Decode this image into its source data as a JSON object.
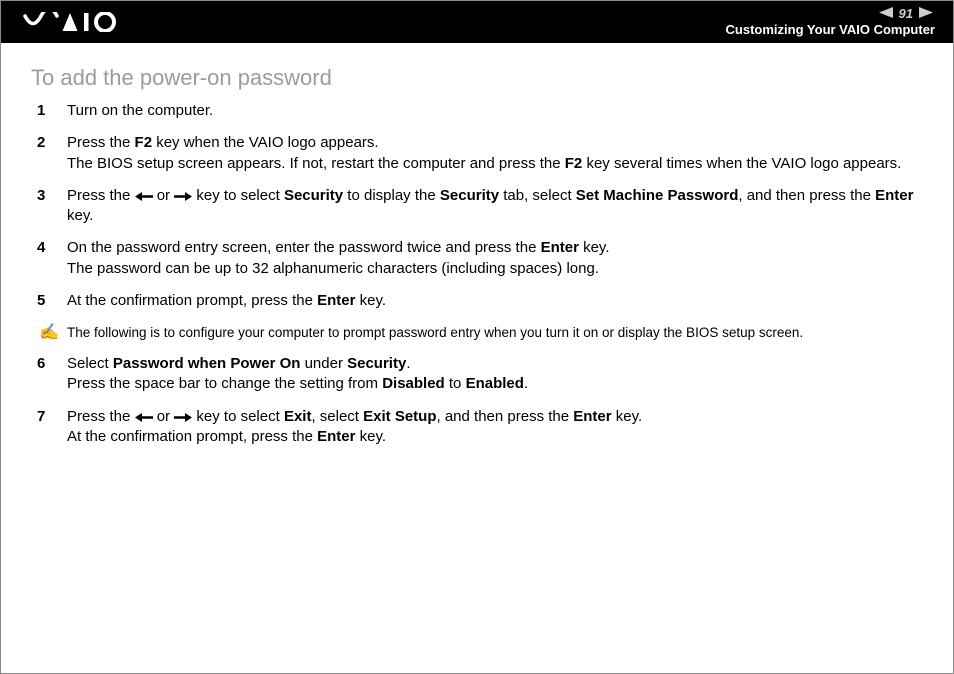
{
  "header": {
    "page_number": "91",
    "section_title": "Customizing Your VAIO Computer"
  },
  "title": "To add the power-on password",
  "steps": {
    "s1": "Turn on the computer.",
    "s2a": "Press the ",
    "s2_f2": "F2",
    "s2b": " key when the VAIO logo appears.",
    "s2c": "The BIOS setup screen appears. If not, restart the computer and press the ",
    "s2d": " key several times when the VAIO logo appears.",
    "s3a": "Press the ",
    "s3_or": " or ",
    "s3b": " key to select ",
    "s3_sec": "Security",
    "s3c": " to display the ",
    "s3d": " tab, select ",
    "s3_smp": "Set Machine Password",
    "s3e": ", and then press the ",
    "s3_enter": "Enter",
    "s3f": " key.",
    "s4a": "On the password entry screen, enter the password twice and press the ",
    "s4b": " key.",
    "s4c": "The password can be up to 32 alphanumeric characters (including spaces) long.",
    "s5a": "At the confirmation prompt, press the ",
    "s5b": " key.",
    "note": "The following is to configure your computer to prompt password entry when you turn it on or display the BIOS setup screen.",
    "s6a": "Select ",
    "s6_pwp": "Password when Power On",
    "s6b": " under ",
    "s6c": ".",
    "s6d": "Press the space bar to change the setting from ",
    "s6_dis": "Disabled",
    "s6e": " to ",
    "s6_en": "Enabled",
    "s6f": ".",
    "s7a": "Press the ",
    "s7b": " key to select ",
    "s7_exit": "Exit",
    "s7c": ", select ",
    "s7_es": "Exit Setup",
    "s7d": ", and then press the ",
    "s7e": " key.",
    "s7f": "At the confirmation prompt, press the ",
    "s7g": " key."
  }
}
